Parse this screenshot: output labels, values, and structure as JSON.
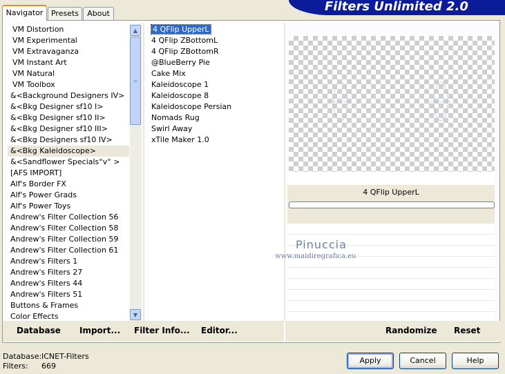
{
  "tabs": [
    {
      "label": "Navigator"
    },
    {
      "label": "Presets"
    },
    {
      "label": "About"
    }
  ],
  "banner": {
    "title": "Filters Unlimited 2.0"
  },
  "categories": [
    "VM Distortion",
    "VM Experimental",
    "VM Extravaganza",
    "VM Instant Art",
    "VM Natural",
    "VM Toolbox",
    "&<Background Designers IV>",
    "&<Bkg Designer sf10 I>",
    "&<Bkg Designer sf10 II>",
    "&<Bkg Designer sf10 III>",
    "&<Bkg Designers sf10 IV>",
    "&<Bkg Kaleidoscope>",
    "&<Sandflower Specials°v° >",
    "[AFS IMPORT]",
    "Alf's Border FX",
    "Alf's Power Grads",
    "Alf's Power Toys",
    "Andrew's Filter Collection 56",
    "Andrew's Filter Collection 58",
    "Andrew's Filter Collection 59",
    "Andrew's Filter Collection 61",
    "Andrew's Filters 1",
    "Andrew's Filters 27",
    "Andrew's Filters 44",
    "Andrew's Filters 51",
    "Buttons & Frames",
    "Color Effects"
  ],
  "filters": [
    "4 QFlip UpperL",
    "4 QFlip ZBottomL",
    "4 QFlip ZBottomR",
    "@BlueBerry Pie",
    "Cake Mix",
    "Kaleidoscope 1",
    "Kaleidoscope 8",
    "Kaleidoscope Persian",
    "Nomads Rug",
    "Swirl Away",
    "xTile Maker 1.0"
  ],
  "preview": {
    "filter_name": "4 QFlip UpperL"
  },
  "watermark": {
    "name": "Pinuccia",
    "url": "www.maidiregrafica.eu"
  },
  "bottom_links": {
    "database": "Database",
    "import": "Import...",
    "filter_info": "Filter Info...",
    "editor": "Editor...",
    "randomize": "Randomize",
    "reset": "Reset"
  },
  "status": {
    "database_label": "Database:",
    "database_value": "ICNET-Filters",
    "filters_label": "Filters:",
    "filters_value": "669"
  },
  "buttons": {
    "apply": "Apply",
    "cancel": "Cancel",
    "help": "Help"
  },
  "colors": {
    "banner": "#0b1c9a",
    "selection": "#316ac5",
    "active_tab_accent": "#e68b2c"
  }
}
